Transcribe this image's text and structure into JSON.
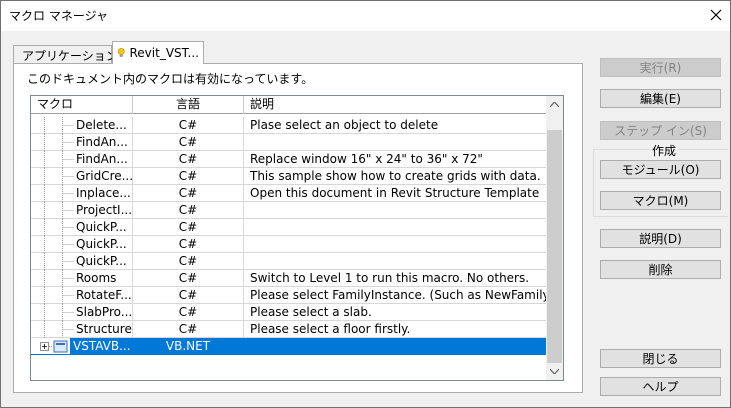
{
  "window": {
    "title": "マクロ マネージャ"
  },
  "tabs": [
    {
      "label": "アプリケーション",
      "icon": "lightbulb-icon"
    },
    {
      "label": "Revit_VST...",
      "icon": "lightbulb-icon"
    }
  ],
  "info_text": "このドキュメント内のマクロは有効になっています。",
  "table": {
    "columns": [
      "マクロ",
      "言語",
      "説明"
    ],
    "rows": [
      {
        "name": "Delete...",
        "lang": "C#",
        "desc": "Plase select an object to delete"
      },
      {
        "name": "FindAn...",
        "lang": "C#",
        "desc": ""
      },
      {
        "name": "FindAn...",
        "lang": "C#",
        "desc": "Replace window 16\" x 24\" to 36\" x 72\""
      },
      {
        "name": "GridCre...",
        "lang": "C#",
        "desc": "This sample show how to create grids with data."
      },
      {
        "name": "Inplace...",
        "lang": "C#",
        "desc": "Open this document in Revit Structure Template"
      },
      {
        "name": "ProjectI...",
        "lang": "C#",
        "desc": ""
      },
      {
        "name": "QuickP...",
        "lang": "C#",
        "desc": ""
      },
      {
        "name": "QuickP...",
        "lang": "C#",
        "desc": ""
      },
      {
        "name": "QuickP...",
        "lang": "C#",
        "desc": ""
      },
      {
        "name": "Rooms",
        "lang": "C#",
        "desc": "Switch to Level 1 to run this macro. No others."
      },
      {
        "name": "RotateF...",
        "lang": "C#",
        "desc": "Please select FamilyInstance. (Such as NewFamilyInsta..."
      },
      {
        "name": "SlabPro...",
        "lang": "C#",
        "desc": "Please select a slab."
      },
      {
        "name": "Structure",
        "lang": "C#",
        "desc": "Please select a floor firstly."
      },
      {
        "name": "VSTAVB...",
        "lang": "VB.NET",
        "desc": ""
      }
    ]
  },
  "buttons": {
    "run": "実行(R)",
    "edit": "編集(E)",
    "step_in": "ステップ イン(S)",
    "create_group": "作成",
    "module": "モジュール(O)",
    "macro": "マクロ(M)",
    "description": "説明(D)",
    "delete": "削除",
    "close": "閉じる",
    "help": "ヘルプ"
  },
  "colors": {
    "selection": "#0078d7",
    "button_face": "#e1e1e1",
    "dialog_bg": "#f0f0f0"
  }
}
